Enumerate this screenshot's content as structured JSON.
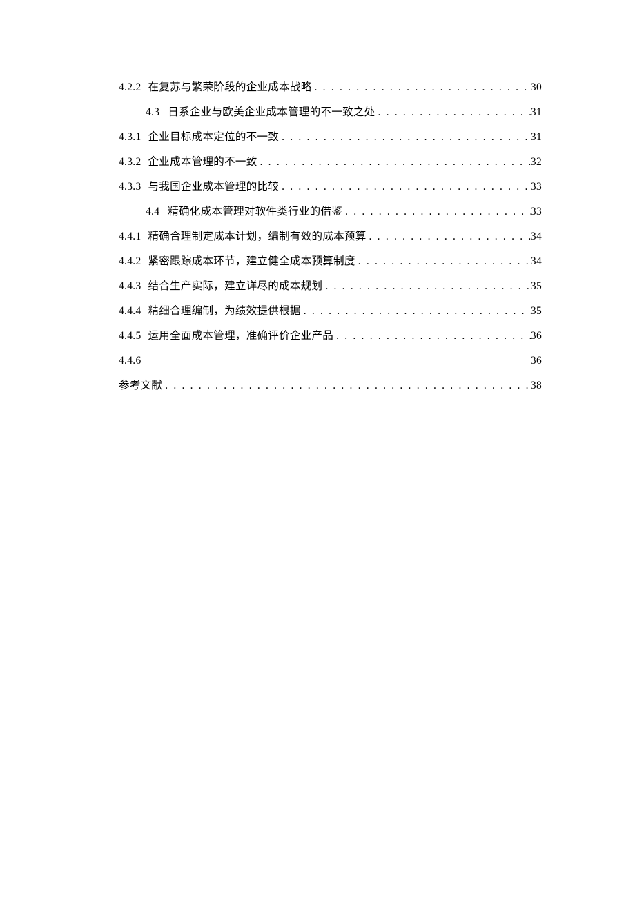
{
  "toc": [
    {
      "type": "sub",
      "num": "4.2.2",
      "title": "在复苏与繁荣阶段的企业成本战略",
      "page": "30",
      "dots": true
    },
    {
      "type": "section",
      "num": "4.3",
      "title": "日系企业与欧美企业成本管理的不一致之处",
      "page": "31",
      "dots": true
    },
    {
      "type": "sub",
      "num": "4.3.1",
      "title": "企业目标成本定位的不一致",
      "page": "31",
      "dots": true
    },
    {
      "type": "sub",
      "num": "4.3.2",
      "title": "企业成本管理的不一致",
      "page": "32",
      "dots": true
    },
    {
      "type": "sub",
      "num": "4.3.3",
      "title": "与我国企业成本管理的比较",
      "page": "33",
      "dots": true
    },
    {
      "type": "section",
      "num": "4.4",
      "title": "精确化成本管理对软件类行业的借鉴",
      "page": "33",
      "dots": true
    },
    {
      "type": "sub",
      "num": "4.4.1",
      "title": "精确合理制定成本计划，编制有效的成本预算",
      "page": "34",
      "dots": true
    },
    {
      "type": "sub",
      "num": "4.4.2",
      "title": "紧密跟踪成本环节，建立健全成本预算制度",
      "page": "34",
      "dots": true
    },
    {
      "type": "sub",
      "num": "4.4.3",
      "title": "结合生产实际，建立详尽的成本规划",
      "page": "35",
      "dots": true
    },
    {
      "type": "sub",
      "num": "4.4.4",
      "title": "精细合理编制，为绩效提供根据",
      "page": "35",
      "dots": true
    },
    {
      "type": "sub",
      "num": "4.4.5",
      "title": "运用全面成本管理，准确评价企业产品",
      "page": "36",
      "dots": true
    },
    {
      "type": "sub",
      "num": "4.4.6",
      "title": "",
      "page": "36",
      "dots": false
    },
    {
      "type": "ref",
      "num": "",
      "title": "参考文献",
      "page": "38",
      "dots": true
    }
  ]
}
